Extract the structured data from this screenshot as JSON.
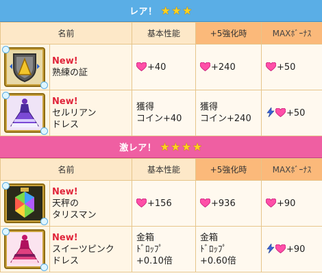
{
  "colors": {
    "heart": "#ff4fa8",
    "rare_header": "#5aaee6",
    "super_rare_header": "#ef5fa2"
  },
  "sections": [
    {
      "title": "レア！",
      "star_count": 3,
      "columns": [
        "名前",
        "基本性能",
        "+5強化時",
        "MAXﾎﾞｰﾅｽ"
      ],
      "items": [
        {
          "icon": "shield-emblem-icon",
          "new_label": "New!",
          "name_lines": [
            "熟練の証",
            ""
          ],
          "base": [
            "+40",
            "",
            ""
          ],
          "plus5": [
            "+240",
            "",
            ""
          ],
          "max": "+50",
          "max_icons": [
            "heart-icon"
          ]
        },
        {
          "icon": "purple-dress-icon",
          "new_label": "New!",
          "name_lines": [
            "セルリアン",
            "ドレス"
          ],
          "base": [
            "獲得",
            "コイン+40",
            ""
          ],
          "plus5": [
            "獲得",
            "コイン+240",
            ""
          ],
          "max": "+50",
          "max_icons": [
            "lightning-icon",
            "heart-icon"
          ]
        }
      ]
    },
    {
      "title": "激レア！",
      "star_count": 4,
      "columns": [
        "名前",
        "基本性能",
        "+5強化時",
        "MAXﾎﾞｰﾅｽ"
      ],
      "items": [
        {
          "icon": "rainbow-crystal-talisman-icon",
          "new_label": "New!",
          "name_lines": [
            "天秤の",
            "タリスマン"
          ],
          "base": [
            "+156",
            "",
            ""
          ],
          "plus5": [
            "+936",
            "",
            ""
          ],
          "max": "+90",
          "max_icons": [
            "heart-icon"
          ]
        },
        {
          "icon": "pink-dress-icon",
          "new_label": "New!",
          "name_lines": [
            "スイーツピンク",
            "ドレス"
          ],
          "base": [
            "金箱",
            "ﾄﾞﾛｯﾌﾟ",
            "+0.10倍"
          ],
          "plus5": [
            "金箱",
            "ﾄﾞﾛｯﾌﾟ",
            "+0.60倍"
          ],
          "max": "+90",
          "max_icons": [
            "lightning-icon",
            "heart-icon"
          ]
        }
      ]
    }
  ]
}
